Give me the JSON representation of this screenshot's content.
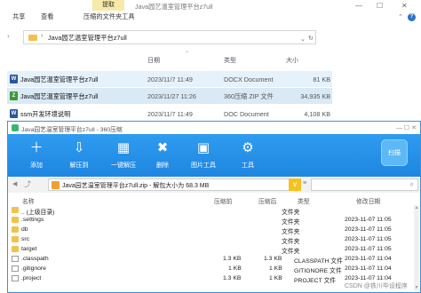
{
  "explorer": {
    "tool_tab": "提取",
    "window_title": "Java园艺温室管理平台z7ull",
    "tabs": [
      "共享",
      "查看",
      "压缩的文件夹工具"
    ],
    "address": "Java园艺温室管理平台z7ull",
    "columns": {
      "date": "日期",
      "type": "类型",
      "size": "大小"
    },
    "files": [
      {
        "icon": "word-icon",
        "name": "Java园艺温室管理平台z7ull",
        "date": "2023/11/7 11:49",
        "type": "DOCX Document",
        "size": "81 KB",
        "icon_color": "#2b579a",
        "glyph": "W"
      },
      {
        "icon": "zip-icon",
        "name": "Java园艺温室管理平台z7ull",
        "date": "2023/11/27 11:26",
        "type": "360压缩 ZIP 文件",
        "size": "34,935 KB",
        "icon_color": "#3a9a3a",
        "glyph": "Z"
      },
      {
        "icon": "doc-icon",
        "name": "ssm开发环境说明",
        "date": "2023/11/7 11:49",
        "type": "DOC Document",
        "size": "4,108 KB",
        "icon_color": "#2b579a",
        "glyph": "W"
      }
    ]
  },
  "zip": {
    "title": "Java园艺温室管理平台z7ull - 360压缩",
    "toolbar": [
      {
        "label": "添加",
        "icon": "add-icon",
        "glyph": "＋"
      },
      {
        "label": "解压到",
        "icon": "extract-to-icon",
        "glyph": "📂"
      },
      {
        "label": "一键解压",
        "icon": "one-click-extract-icon",
        "glyph": "▦"
      },
      {
        "label": "删除",
        "icon": "delete-icon",
        "glyph": "🗑"
      },
      {
        "label": "图片工具",
        "icon": "image-tool-icon",
        "glyph": "▣"
      },
      {
        "label": "工具",
        "icon": "tools-icon",
        "glyph": "⚙"
      }
    ],
    "scan_label": "扫描",
    "path": "Java园艺温室管理平台z7ull.zip - 解包大小为 68.3 MB",
    "columns": {
      "name": "名称",
      "compressed": "压缩前",
      "original": "压缩后",
      "type": "类型",
      "modified": "修改日期"
    },
    "rows": [
      {
        "kind": "upper",
        "name": ".. (上级目录)",
        "compressed": "",
        "original": "",
        "type": "文件夹",
        "modified": ""
      },
      {
        "kind": "folder",
        "name": ".settings",
        "compressed": "",
        "original": "",
        "type": "文件夹",
        "modified": "2023-11-07 11:05"
      },
      {
        "kind": "folder",
        "name": "db",
        "compressed": "",
        "original": "",
        "type": "文件夹",
        "modified": "2023-11-07 11:05"
      },
      {
        "kind": "folder",
        "name": "src",
        "compressed": "",
        "original": "",
        "type": "文件夹",
        "modified": "2023-11-07 11:05"
      },
      {
        "kind": "folder",
        "name": "target",
        "compressed": "",
        "original": "",
        "type": "文件夹",
        "modified": "2023-11-07 11:05"
      },
      {
        "kind": "file",
        "name": ".classpath",
        "compressed": "1.3 KB",
        "original": "1.3 KB",
        "type": "CLASSPATH 文件",
        "modified": "2023-11-07 11:04"
      },
      {
        "kind": "file",
        "name": ".gitignore",
        "compressed": "1 KB",
        "original": "1 KB",
        "type": "GITIGNORE 文件",
        "modified": "2023-11-07 11:04"
      },
      {
        "kind": "file",
        "name": ".project",
        "compressed": "1.3 KB",
        "original": "1 KB",
        "type": "PROJECT 文件",
        "modified": "2023-11-07 11:04"
      }
    ]
  },
  "watermark": "CSDN @铁川毕设程序"
}
